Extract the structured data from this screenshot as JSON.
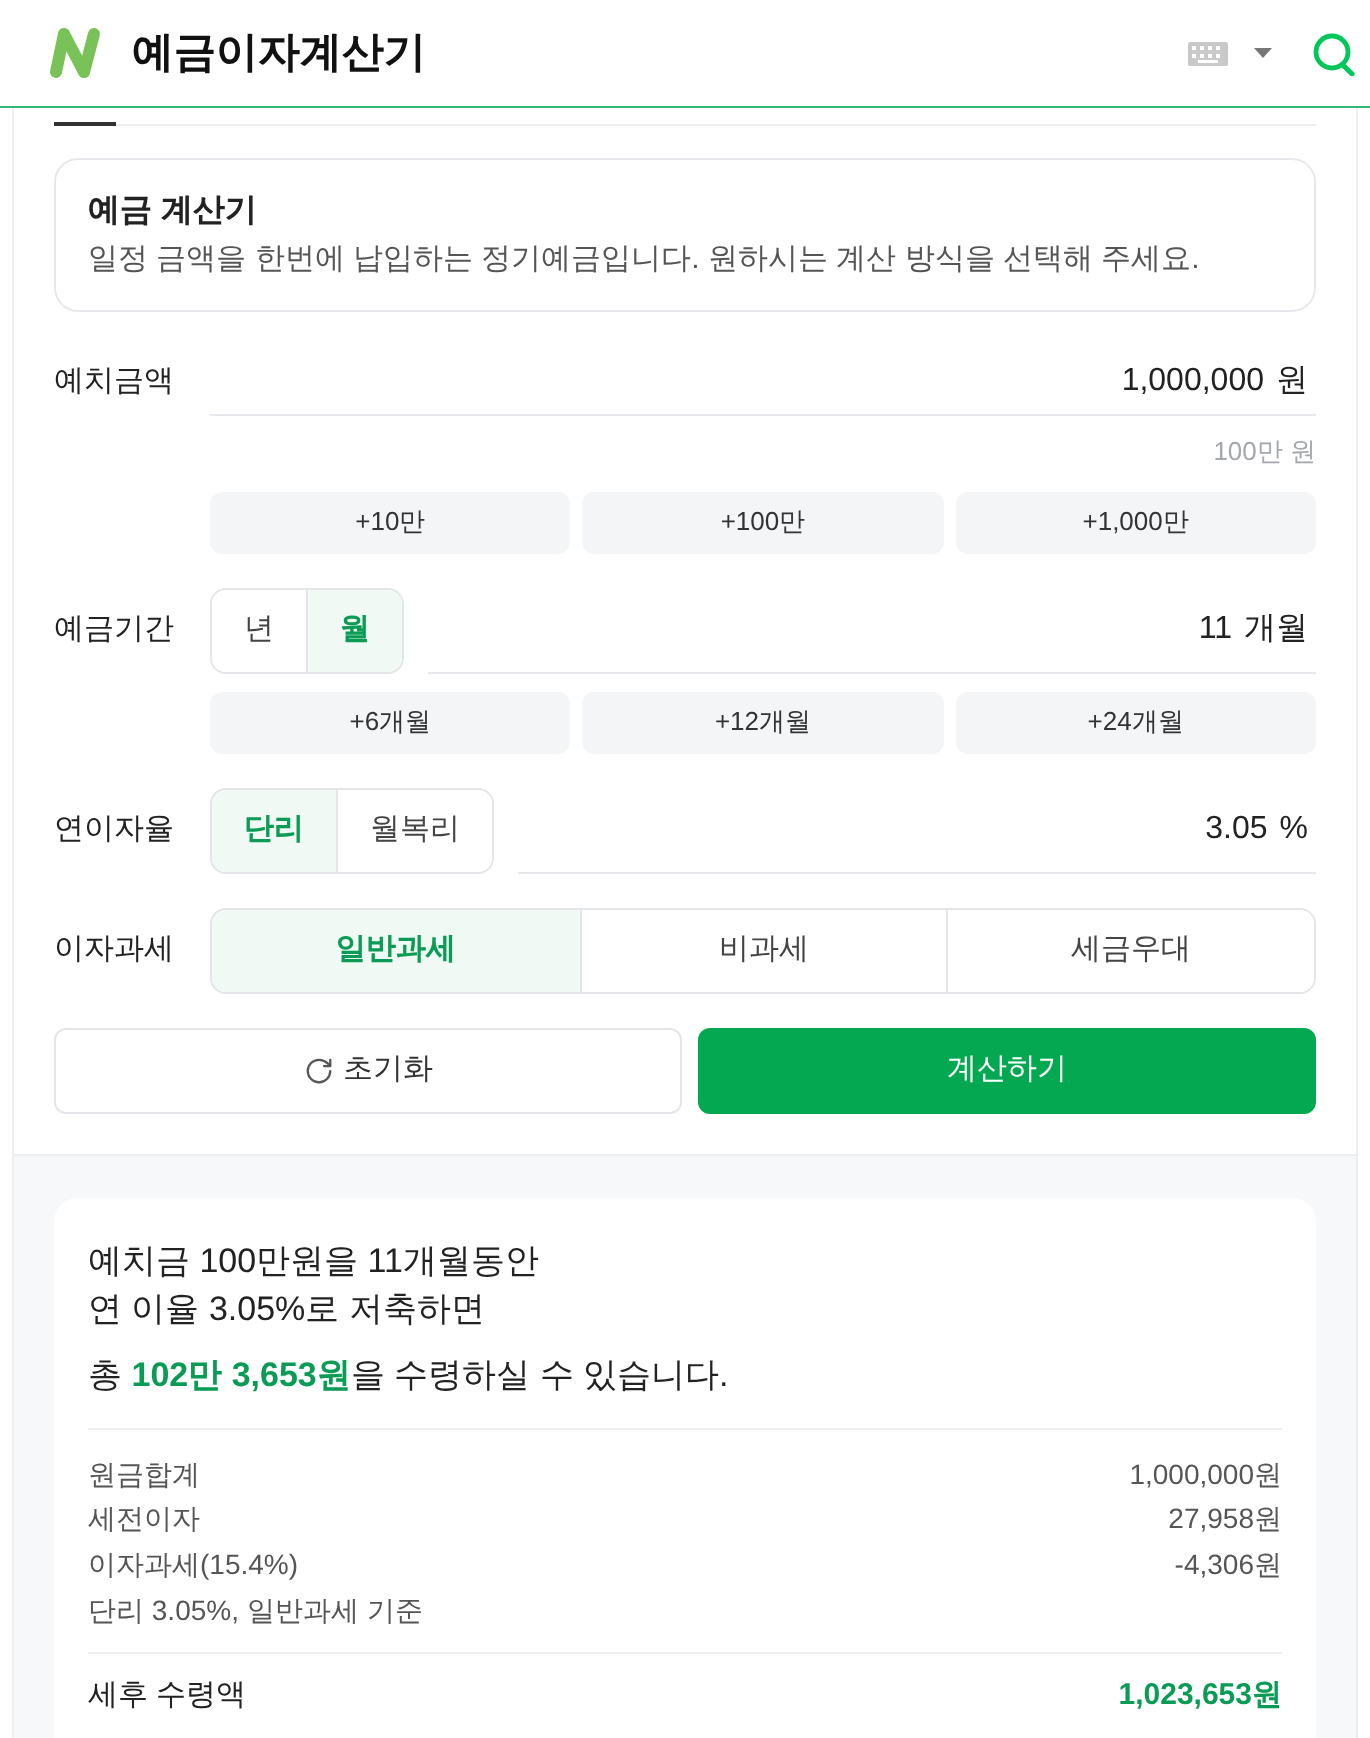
{
  "header": {
    "title": "예금이자계산기"
  },
  "intro": {
    "title": "예금 계산기",
    "description": "일정 금액을 한번에 납입하는 정기예금입니다. 원하시는 계산 방식을 선택해 주세요."
  },
  "form": [
    {
      "kind": "input",
      "label": "예치금액",
      "value": "1,000,000",
      "unit": "원",
      "hint": "100만 원",
      "quick_buttons": [
        "+10만",
        "+100만",
        "+1,000만"
      ]
    },
    {
      "kind": "input",
      "label": "예금기간",
      "toggle": [
        {
          "label": "년",
          "selected": false
        },
        {
          "label": "월",
          "selected": true
        }
      ],
      "value": "11",
      "unit": "개월",
      "quick_buttons": [
        "+6개월",
        "+12개월",
        "+24개월"
      ]
    },
    {
      "kind": "input",
      "label": "연이자율",
      "toggle": [
        {
          "label": "단리",
          "selected": true
        },
        {
          "label": "월복리",
          "selected": false
        }
      ],
      "value": "3.05",
      "unit": "%"
    },
    {
      "kind": "segments",
      "label": "이자과세",
      "options": [
        {
          "label": "일반과세",
          "selected": true
        },
        {
          "label": "비과세",
          "selected": false
        },
        {
          "label": "세금우대",
          "selected": false
        }
      ]
    }
  ],
  "actions": {
    "reset": "초기화",
    "calculate": "계산하기"
  },
  "result": {
    "summary_lines": [
      "예치금 100만원을 11개월동안",
      "연 이율 3.05%로 저축하면"
    ],
    "total": "총 **102만 3,653원**을 수령하실 수 있습니다.",
    "details": [
      {
        "label": "원금합계",
        "value": "1,000,000원"
      },
      {
        "label": "세전이자",
        "value": "27,958원"
      },
      {
        "label": "이자과세(15.4%)",
        "value": "-4,306원"
      }
    ],
    "basis": "단리 3.05%, 일반과세 기준",
    "net": {
      "label": "세후 수령액",
      "value": "1,023,653원"
    }
  }
}
